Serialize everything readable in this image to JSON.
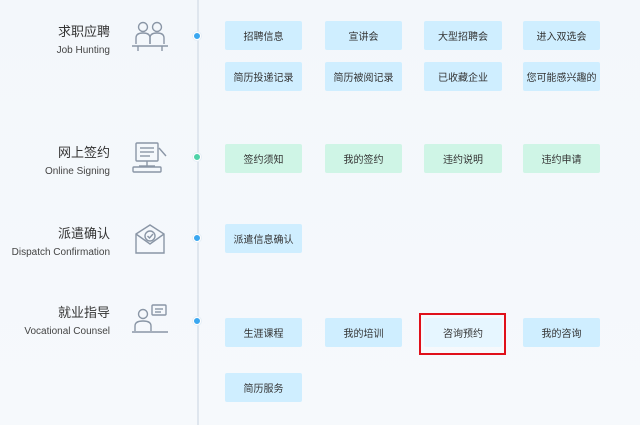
{
  "colors": {
    "blue_button": "#cfeeff",
    "green_button": "#cff5e6",
    "dot_blue": "#3aa7f0",
    "dot_green": "#4fd2a8",
    "highlight": "#e0101a"
  },
  "sections": [
    {
      "title_zh": "求职应聘",
      "title_en": "Job Hunting",
      "icon": "job-seekers-icon",
      "buttons": [
        "招聘信息",
        "宣讲会",
        "大型招聘会",
        "进入双选会",
        "简历投递记录",
        "简历被阅记录",
        "已收藏企业",
        "您可能感兴趣的"
      ]
    },
    {
      "title_zh": "网上签约",
      "title_en": "Online Signing",
      "icon": "computer-signing-icon",
      "buttons": [
        "签约须知",
        "我的签约",
        "违约说明",
        "违约申请"
      ]
    },
    {
      "title_zh": "派遣确认",
      "title_en": "Dispatch Confirmation",
      "icon": "envelope-check-icon",
      "buttons": [
        "派遣信息确认"
      ]
    },
    {
      "title_zh": "就业指导",
      "title_en": "Vocational Counsel",
      "icon": "counselor-icon",
      "buttons": [
        "生涯课程",
        "我的培训",
        "咨询预约",
        "我的咨询",
        "简历服务"
      ]
    }
  ]
}
